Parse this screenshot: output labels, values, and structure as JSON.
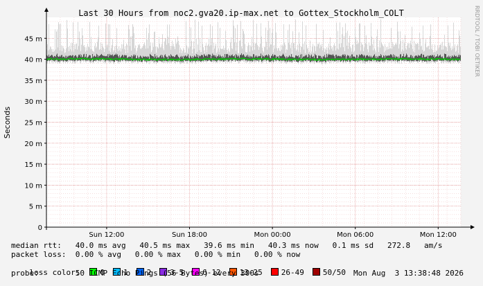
{
  "chart_data": {
    "type": "line",
    "title": "Last 30 Hours from noc2.gva20.ip-max.net to Gottex_Stockholm_COLT",
    "ylabel": "Seconds",
    "ylim": [
      0,
      0.05
    ],
    "y_ticks": [
      {
        "value": 0,
        "label": "0"
      },
      {
        "value": 0.005,
        "label": "5 m"
      },
      {
        "value": 0.01,
        "label": "10 m"
      },
      {
        "value": 0.015,
        "label": "15 m"
      },
      {
        "value": 0.02,
        "label": "20 m"
      },
      {
        "value": 0.025,
        "label": "25 m"
      },
      {
        "value": 0.03,
        "label": "30 m"
      },
      {
        "value": 0.035,
        "label": "35 m"
      },
      {
        "value": 0.04,
        "label": "40 m"
      },
      {
        "value": 0.045,
        "label": "45 m"
      }
    ],
    "x_range_hours": [
      -30,
      0
    ],
    "x_ticks": [
      {
        "hours": -25.64,
        "label": "Sun 12:00"
      },
      {
        "hours": -19.64,
        "label": "Sun 18:00"
      },
      {
        "hours": -13.64,
        "label": "Mon 00:00"
      },
      {
        "hours": -7.64,
        "label": "Mon 06:00"
      },
      {
        "hours": -1.64,
        "label": "Mon 12:00"
      }
    ],
    "series": [
      {
        "name": "median rtt",
        "color": "#00cc00",
        "base_ms": 40.0,
        "min_ms": 39.6,
        "max_ms": 40.5
      }
    ]
  },
  "watermark": "RRDTOOL / TOBI OETIKER",
  "legend": {
    "median_rtt": "median rtt:   40.0 ms avg   40.5 ms max   39.6 ms min   40.3 ms now   0.1 ms sd   272.8   am/s",
    "packet_loss": "packet loss:  0.00 % avg   0.00 % max   0.00 % min   0.00 % now",
    "loss_color_label": "loss color:",
    "loss_colors": [
      {
        "label": "0",
        "color": "#00ff00"
      },
      {
        "label": "1",
        "color": "#00bbff"
      },
      {
        "label": "2",
        "color": "#0066ff"
      },
      {
        "label": "3-5",
        "color": "#8a2be2"
      },
      {
        "label": "6-12",
        "color": "#ff00ff"
      },
      {
        "label": "13-25",
        "color": "#ff5500"
      },
      {
        "label": "26-49",
        "color": "#ff0000"
      },
      {
        "label": "50/50",
        "color": "#a00000"
      }
    ],
    "probe": "probe:        50 ICMP Echo Pings (56 Bytes) every 300s",
    "timestamp": "Mon Aug  3 13:38:48 2026"
  }
}
